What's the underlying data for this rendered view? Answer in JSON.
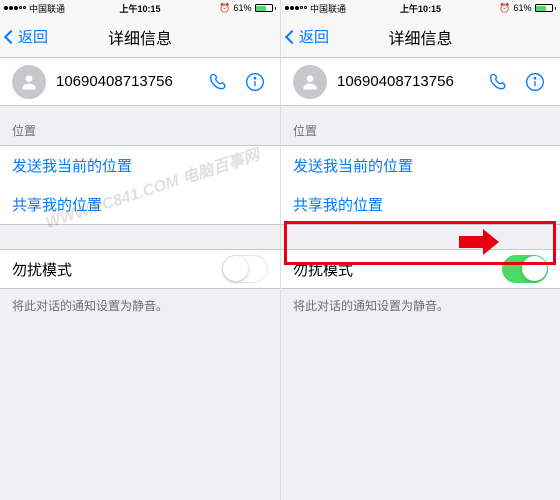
{
  "statusbar": {
    "carrier": "中国联通",
    "time": "上午10:15",
    "battery_pct": "61%",
    "alarm_icon": "⏰",
    "bt_icon": "ᛒ"
  },
  "nav": {
    "back": "返回",
    "title": "详细信息"
  },
  "contact": {
    "name": "10690408713756"
  },
  "sections": {
    "location_header": "位置",
    "send_my_location": "发送我当前的位置",
    "share_my_location": "共享我的位置",
    "dnd_label": "勿扰模式",
    "dnd_footnote": "将此对话的通知设置为静音。"
  },
  "watermark": "WWW.PC841.COM 电脑百事网"
}
